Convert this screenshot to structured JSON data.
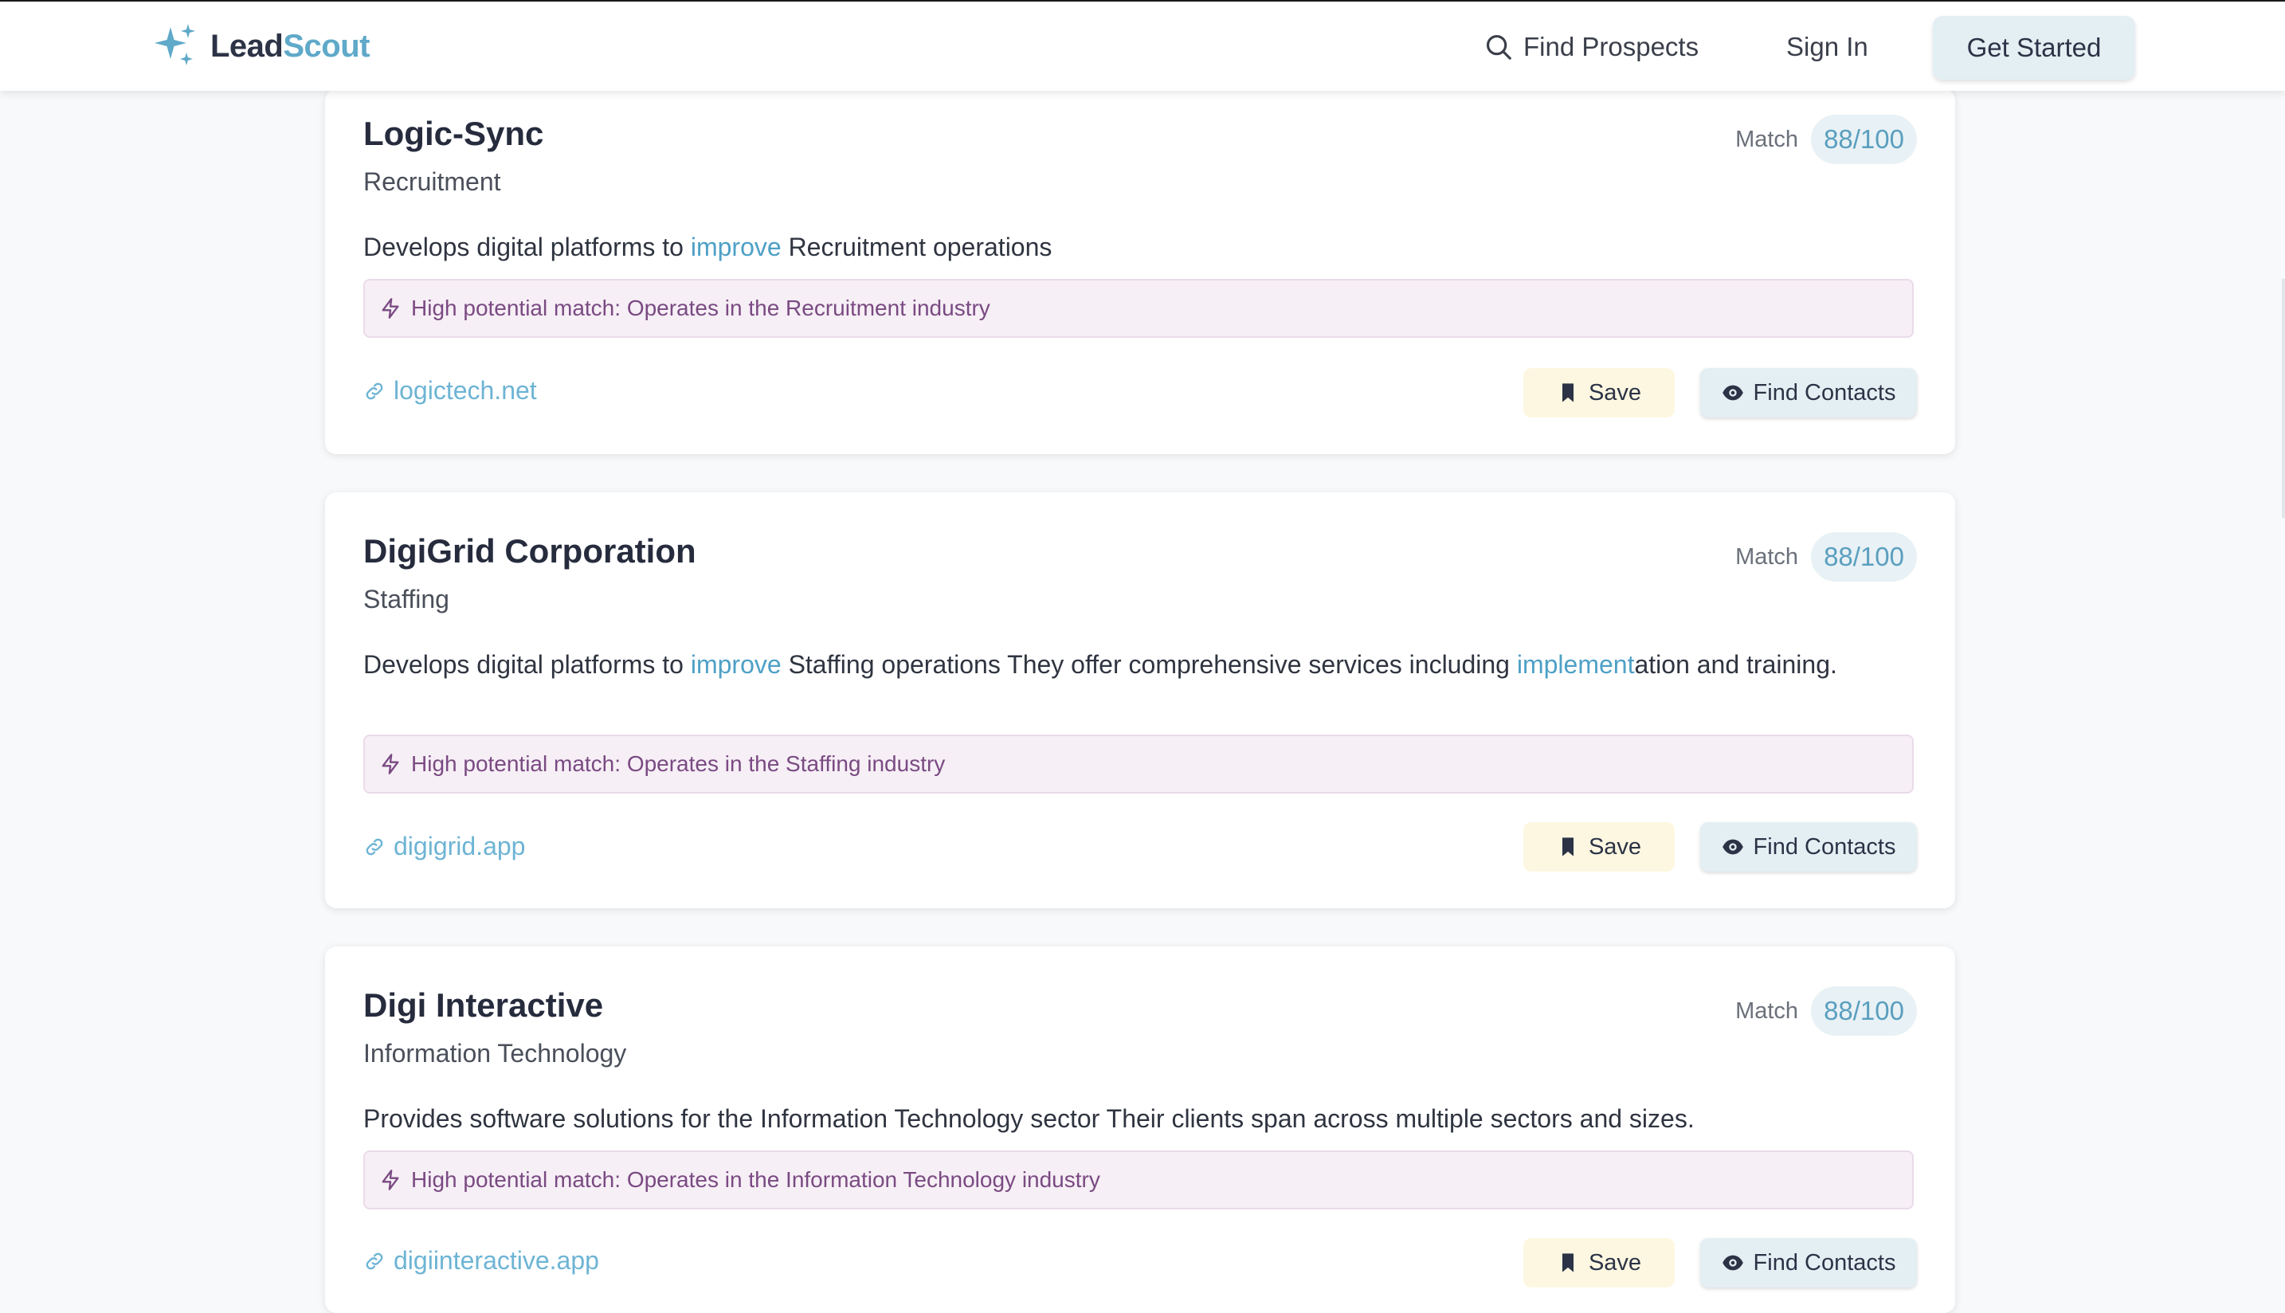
{
  "header": {
    "logo_part1": "Lead",
    "logo_part2": "Scout",
    "nav_find": "Find Prospects",
    "nav_signin": "Sign In",
    "cta": "Get Started"
  },
  "colors": {
    "brand": "#5fa9c9",
    "dark": "#2c3346",
    "highlight": "#4ea0c6",
    "reason_text": "#7a4a82"
  },
  "cards": [
    {
      "name": "Logic-Sync",
      "industry": "Recruitment",
      "match_label": "Match",
      "score": "88/100",
      "desc_parts": [
        "Develops digital platforms to ",
        "improve",
        " Recruitment operations"
      ],
      "reason": "High potential match: Operates in the Recruitment industry",
      "website": "logictech.net",
      "save_label": "Save",
      "contacts_label": "Find Contacts"
    },
    {
      "name": "DigiGrid Corporation",
      "industry": "Staffing",
      "match_label": "Match",
      "score": "88/100",
      "desc_parts": [
        "Develops digital platforms to ",
        "improve",
        " Staffing operations They offer comprehensive services including ",
        "implement",
        "ation and training."
      ],
      "reason": "High potential match: Operates in the Staffing industry",
      "website": "digigrid.app",
      "save_label": "Save",
      "contacts_label": "Find Contacts"
    },
    {
      "name": "Digi Interactive",
      "industry": "Information Technology",
      "match_label": "Match",
      "score": "88/100",
      "desc_parts": [
        "Provides software solutions for the Information Technology sector Their clients span across multiple sectors and sizes."
      ],
      "reason": "High potential match: Operates in the Information Technology industry",
      "website": "digiinteractive.app",
      "save_label": "Save",
      "contacts_label": "Find Contacts"
    }
  ]
}
